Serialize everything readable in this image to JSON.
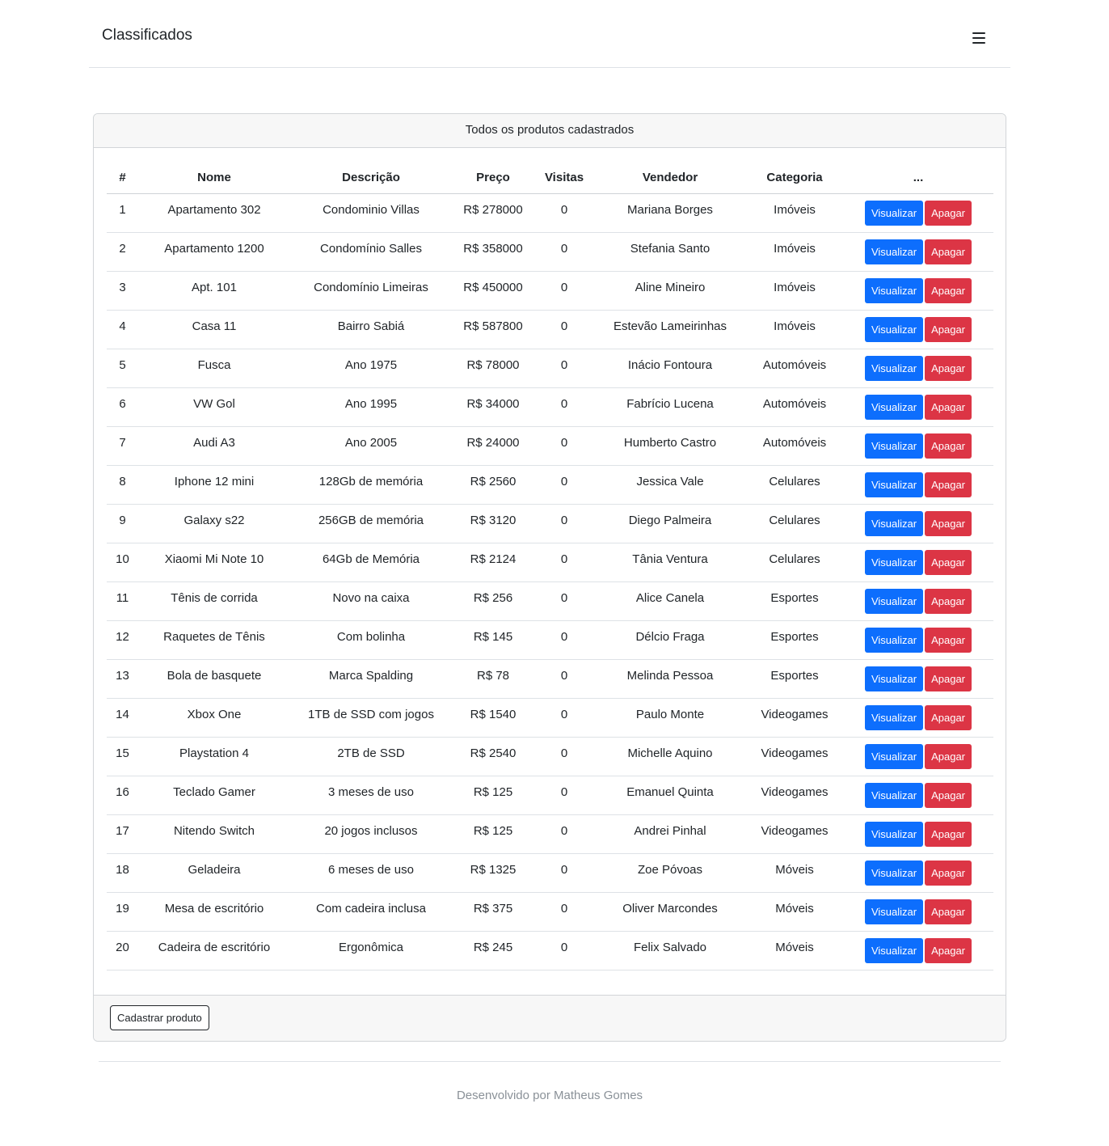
{
  "navbar": {
    "brand": "Classificados",
    "menu_icon": "hamburger-menu-icon"
  },
  "card": {
    "title": "Todos os produtos cadastrados",
    "add_button": "Cadastrar produto"
  },
  "table": {
    "headers": [
      "#",
      "Nome",
      "Descrição",
      "Preço",
      "Visitas",
      "Vendedor",
      "Categoria",
      "..."
    ],
    "view_label": "Visualizar",
    "delete_label": "Apagar",
    "rows": [
      {
        "id": "1",
        "nome": "Apartamento 302",
        "descricao": "Condominio Villas",
        "preco": "R$ 278000",
        "visitas": "0",
        "vendedor": "Mariana Borges",
        "categoria": "Imóveis"
      },
      {
        "id": "2",
        "nome": "Apartamento 1200",
        "descricao": "Condomínio Salles",
        "preco": "R$ 358000",
        "visitas": "0",
        "vendedor": "Stefania Santo",
        "categoria": "Imóveis"
      },
      {
        "id": "3",
        "nome": "Apt. 101",
        "descricao": "Condomínio Limeiras",
        "preco": "R$ 450000",
        "visitas": "0",
        "vendedor": "Aline Mineiro",
        "categoria": "Imóveis"
      },
      {
        "id": "4",
        "nome": "Casa 11",
        "descricao": "Bairro Sabiá",
        "preco": "R$ 587800",
        "visitas": "0",
        "vendedor": "Estevão Lameirinhas",
        "categoria": "Imóveis"
      },
      {
        "id": "5",
        "nome": "Fusca",
        "descricao": "Ano 1975",
        "preco": "R$ 78000",
        "visitas": "0",
        "vendedor": "Inácio Fontoura",
        "categoria": "Automóveis"
      },
      {
        "id": "6",
        "nome": "VW Gol",
        "descricao": "Ano 1995",
        "preco": "R$ 34000",
        "visitas": "0",
        "vendedor": "Fabrício Lucena",
        "categoria": "Automóveis"
      },
      {
        "id": "7",
        "nome": "Audi A3",
        "descricao": "Ano 2005",
        "preco": "R$ 24000",
        "visitas": "0",
        "vendedor": "Humberto Castro",
        "categoria": "Automóveis"
      },
      {
        "id": "8",
        "nome": "Iphone 12 mini",
        "descricao": "128Gb de memória",
        "preco": "R$ 2560",
        "visitas": "0",
        "vendedor": "Jessica Vale",
        "categoria": "Celulares"
      },
      {
        "id": "9",
        "nome": "Galaxy s22",
        "descricao": "256GB de memória",
        "preco": "R$ 3120",
        "visitas": "0",
        "vendedor": "Diego Palmeira",
        "categoria": "Celulares"
      },
      {
        "id": "10",
        "nome": "Xiaomi Mi Note 10",
        "descricao": "64Gb de Memória",
        "preco": "R$ 2124",
        "visitas": "0",
        "vendedor": "Tânia Ventura",
        "categoria": "Celulares"
      },
      {
        "id": "11",
        "nome": "Tênis de corrida",
        "descricao": "Novo na caixa",
        "preco": "R$ 256",
        "visitas": "0",
        "vendedor": "Alice Canela",
        "categoria": "Esportes"
      },
      {
        "id": "12",
        "nome": "Raquetes de Tênis",
        "descricao": "Com bolinha",
        "preco": "R$ 145",
        "visitas": "0",
        "vendedor": "Délcio Fraga",
        "categoria": "Esportes"
      },
      {
        "id": "13",
        "nome": "Bola de basquete",
        "descricao": "Marca Spalding",
        "preco": "R$ 78",
        "visitas": "0",
        "vendedor": "Melinda Pessoa",
        "categoria": "Esportes"
      },
      {
        "id": "14",
        "nome": "Xbox One",
        "descricao": "1TB de SSD com jogos",
        "preco": "R$ 1540",
        "visitas": "0",
        "vendedor": "Paulo Monte",
        "categoria": "Videogames"
      },
      {
        "id": "15",
        "nome": "Playstation 4",
        "descricao": "2TB de SSD",
        "preco": "R$ 2540",
        "visitas": "0",
        "vendedor": "Michelle Aquino",
        "categoria": "Videogames"
      },
      {
        "id": "16",
        "nome": "Teclado Gamer",
        "descricao": "3 meses de uso",
        "preco": "R$ 125",
        "visitas": "0",
        "vendedor": "Emanuel Quinta",
        "categoria": "Videogames"
      },
      {
        "id": "17",
        "nome": "Nitendo Switch",
        "descricao": "20 jogos inclusos",
        "preco": "R$ 125",
        "visitas": "0",
        "vendedor": "Andrei Pinhal",
        "categoria": "Videogames"
      },
      {
        "id": "18",
        "nome": "Geladeira",
        "descricao": "6 meses de uso",
        "preco": "R$ 1325",
        "visitas": "0",
        "vendedor": "Zoe Póvoas",
        "categoria": "Móveis"
      },
      {
        "id": "19",
        "nome": "Mesa de escritório",
        "descricao": "Com cadeira inclusa",
        "preco": "R$ 375",
        "visitas": "0",
        "vendedor": "Oliver Marcondes",
        "categoria": "Móveis"
      },
      {
        "id": "20",
        "nome": "Cadeira de escritório",
        "descricao": "Ergonômica",
        "preco": "R$ 245",
        "visitas": "0",
        "vendedor": "Felix Salvado",
        "categoria": "Móveis"
      }
    ]
  },
  "footer": {
    "text": "Desenvolvido por Matheus Gomes"
  },
  "colors": {
    "primary": "#0d6efd",
    "danger": "#dc3545",
    "card_header_bg": "#f7f7f7",
    "footer_text": "#8a9198"
  }
}
